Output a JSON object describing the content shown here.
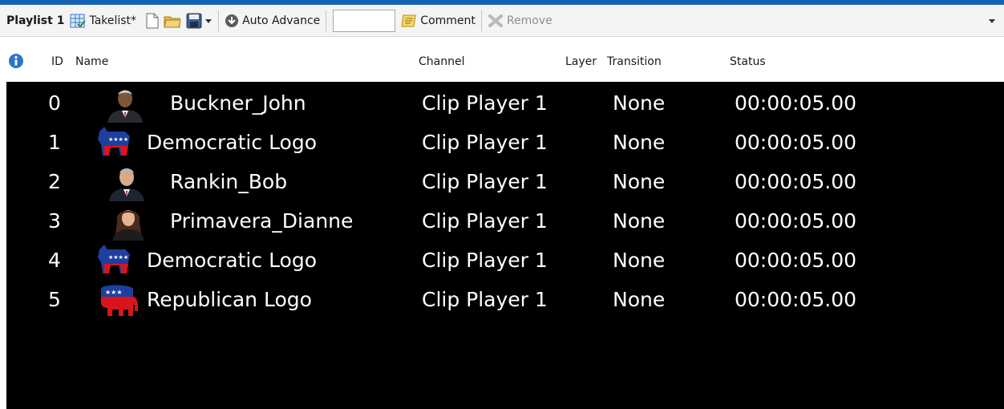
{
  "toolbar": {
    "title": "Playlist 1",
    "takelist_label": "Takelist*",
    "auto_advance_label": "Auto Advance",
    "input_value": "",
    "comment_label": "Comment",
    "remove_label": "Remove"
  },
  "columns": {
    "id": "ID",
    "name": "Name",
    "channel": "Channel",
    "layer": "Layer",
    "transition": "Transition",
    "status": "Status"
  },
  "rows": [
    {
      "id": "0",
      "name": "Buckner_John",
      "thumb": "portrait-man-icon",
      "channel": "Clip Player 1",
      "transition": "None",
      "status": "00:00:05.00"
    },
    {
      "id": "1",
      "name": "Democratic Logo",
      "thumb": "donkey-logo-icon",
      "channel": "Clip Player 1",
      "transition": "None",
      "status": "00:00:05.00"
    },
    {
      "id": "2",
      "name": "Rankin_Bob",
      "thumb": "portrait-man-icon",
      "channel": "Clip Player 1",
      "transition": "None",
      "status": "00:00:05.00"
    },
    {
      "id": "3",
      "name": "Primavera_Dianne",
      "thumb": "portrait-woman-icon",
      "channel": "Clip Player 1",
      "transition": "None",
      "status": "00:00:05.00"
    },
    {
      "id": "4",
      "name": "Democratic Logo",
      "thumb": "donkey-logo-icon",
      "channel": "Clip Player 1",
      "transition": "None",
      "status": "00:00:05.00"
    },
    {
      "id": "5",
      "name": "Republican Logo",
      "thumb": "elephant-logo-icon",
      "channel": "Clip Player 1",
      "transition": "None",
      "status": "00:00:05.00"
    }
  ],
  "colors": {
    "accent": "#1462b4",
    "grid_background": "#000000",
    "grid_text": "#ffffff",
    "democrat_blue": "#1e3f9e",
    "republican_red": "#d8141c"
  }
}
